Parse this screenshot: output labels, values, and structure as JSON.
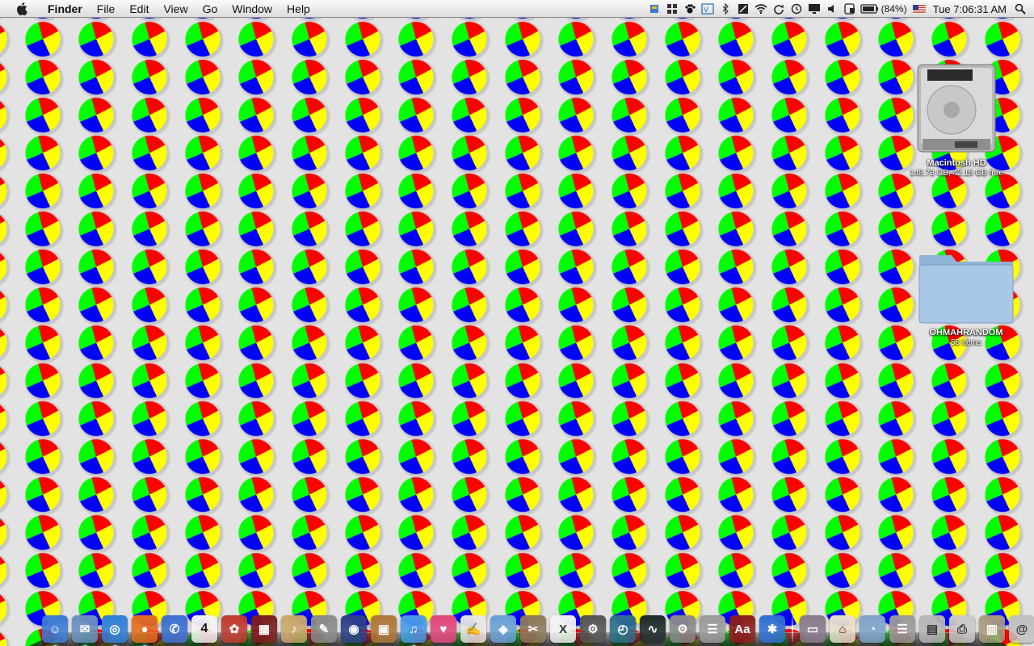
{
  "menubar": {
    "app_name": "Finder",
    "menus": [
      "File",
      "Edit",
      "View",
      "Go",
      "Window",
      "Help"
    ],
    "status_icons": [
      "flag-icon",
      "spaces-icon",
      "paw-icon",
      "vpn-icon",
      "bluetooth-icon",
      "display-icon",
      "wifi-icon",
      "sync-icon",
      "time-machine-icon",
      "monitor-icon",
      "volume-icon",
      "hardware-icon",
      "battery-icon"
    ],
    "battery_percent": "(84%)",
    "input_flag": "us-flag-icon",
    "clock": "Tue 7:06:31 AM",
    "search_icon": "spotlight-icon"
  },
  "desktop": {
    "hd": {
      "name": "Macintosh HD",
      "info": "148.73 GB, 42.15 GB free"
    },
    "folder": {
      "name": "OHMAHRANDOM",
      "info": "58 items"
    }
  },
  "wallpaper_colors": [
    "#ff0000",
    "#ffff00",
    "#0000ff",
    "#00ff00"
  ],
  "dock": {
    "apps": [
      {
        "name": "finder-icon",
        "color": "#3a7bd5",
        "glyph": "☺",
        "running": true
      },
      {
        "name": "mail-icon",
        "color": "#6b8fbf",
        "glyph": "✉",
        "running": true
      },
      {
        "name": "safari-icon",
        "color": "#2f7fd8",
        "glyph": "◎",
        "running": true
      },
      {
        "name": "firefox-icon",
        "color": "#e56b1f",
        "glyph": "●",
        "running": true
      },
      {
        "name": "ichat-icon",
        "color": "#3b6fd1",
        "glyph": "✆",
        "running": false
      },
      {
        "name": "ical-icon",
        "color": "#f4f4f4",
        "glyph": "4",
        "running": false
      },
      {
        "name": "photo-flower-icon",
        "color": "#c0392b",
        "glyph": "✿",
        "running": false
      },
      {
        "name": "film-icon",
        "color": "#7b1e1e",
        "glyph": "▦",
        "running": false
      },
      {
        "name": "garageband-icon",
        "color": "#caa66b",
        "glyph": "♪",
        "running": false
      },
      {
        "name": "paintbrush-icon",
        "color": "#8a8a8a",
        "glyph": "✎",
        "running": false
      },
      {
        "name": "aperture-icon",
        "color": "#2b3f8a",
        "glyph": "◉",
        "running": false
      },
      {
        "name": "iphoto-icon",
        "color": "#b0763a",
        "glyph": "▣",
        "running": false
      },
      {
        "name": "itunes-icon",
        "color": "#4a9ae8",
        "glyph": "♫",
        "running": true
      },
      {
        "name": "heart-icon",
        "color": "#e0457b",
        "glyph": "♥",
        "running": false
      },
      {
        "name": "textedit-icon",
        "color": "#e6e6e6",
        "glyph": "✍",
        "running": false
      },
      {
        "name": "virtualbox-icon",
        "color": "#6aa0d6",
        "glyph": "◈",
        "running": false
      },
      {
        "name": "gimp-icon",
        "color": "#8c7a5b",
        "glyph": "✂",
        "running": false
      },
      {
        "name": "x11-icon",
        "color": "#f2f2f2",
        "glyph": "X",
        "running": false
      },
      {
        "name": "utility-icon",
        "color": "#555555",
        "glyph": "⚙",
        "running": false
      },
      {
        "name": "time-machine-icon",
        "color": "#2f6e8e",
        "glyph": "◴",
        "running": false
      },
      {
        "name": "activity-monitor-icon",
        "color": "#1e2a2a",
        "glyph": "∿",
        "running": false
      },
      {
        "name": "system-prefs-icon",
        "color": "#8a8a8a",
        "glyph": "⚙",
        "running": false
      },
      {
        "name": "scripts-icon",
        "color": "#9a9a9a",
        "glyph": "☰",
        "running": false
      },
      {
        "name": "dictionary-icon",
        "color": "#8b1e1e",
        "glyph": "Aa",
        "running": false
      },
      {
        "name": "bluetooth-icon",
        "color": "#2f6fd1",
        "glyph": "✱",
        "running": false
      }
    ],
    "stacks": [
      {
        "name": "applications-stack-icon",
        "color": "#8a7a8a",
        "glyph": "▭"
      },
      {
        "name": "home-icon",
        "color": "#e8e0cc",
        "glyph": "⌂"
      },
      {
        "name": "documents-folder-icon",
        "color": "#7fa3c8",
        "glyph": "◔"
      },
      {
        "name": "downloads-stack-icon",
        "color": "#9a9a9a",
        "glyph": "☰"
      },
      {
        "name": "pictures-stack-icon",
        "color": "#b5b5b5",
        "glyph": "▤"
      },
      {
        "name": "printer-icon",
        "color": "#c8c8c8",
        "glyph": "⎙"
      },
      {
        "name": "archive-icon",
        "color": "#a89a80",
        "glyph": "▥"
      },
      {
        "name": "network-icon",
        "color": "#c0c0c0",
        "glyph": "@"
      },
      {
        "name": "trash-icon",
        "color": "#bfbfbf",
        "glyph": "🗑"
      }
    ]
  }
}
